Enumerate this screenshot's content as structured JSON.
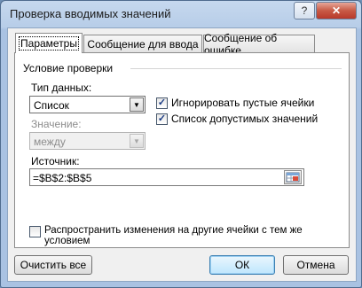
{
  "window": {
    "title": "Проверка вводимых значений",
    "help_label": "?",
    "close_label": "✕"
  },
  "tabs": [
    {
      "label": "Параметры",
      "active": true
    },
    {
      "label": "Сообщение для ввода",
      "active": false
    },
    {
      "label": "Сообщение об ошибке",
      "active": false
    }
  ],
  "panel": {
    "group_title": "Условие проверки",
    "data_type_label": "Тип данных:",
    "data_type_value": "Список",
    "ignore_blank_label": "Игнорировать пустые ячейки",
    "ignore_blank_checked": true,
    "in_cell_dropdown_label": "Список допустимых значений",
    "in_cell_dropdown_checked": true,
    "value_label": "Значение:",
    "value_value": "между",
    "source_label": "Источник:",
    "source_value": "=$B$2:$B$5"
  },
  "apply_all_label": "Распространить изменения на другие ячейки с тем же условием",
  "apply_all_checked": false,
  "buttons": {
    "clear_all": "Очистить все",
    "ok": "ОК",
    "cancel": "Отмена"
  },
  "icons": {
    "close": "close-icon",
    "help": "help-icon",
    "dropdown": "chevron-down-icon",
    "range_picker": "range-select-icon",
    "check": "checkmark-icon"
  }
}
